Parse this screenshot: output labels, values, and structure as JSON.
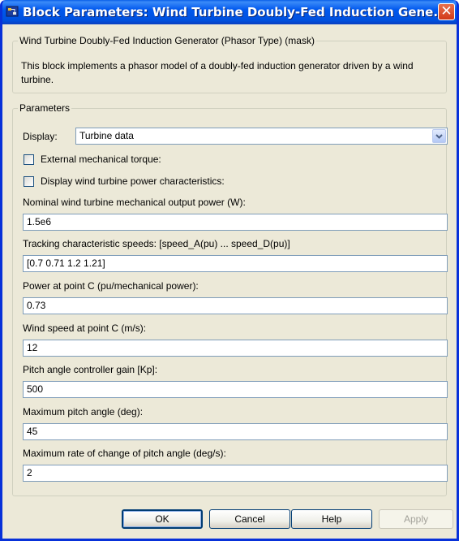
{
  "window": {
    "title": "Block Parameters: Wind Turbine Doubly-Fed Induction Gene...",
    "close_glyph": "✕"
  },
  "description_group": {
    "legend": "Wind Turbine Doubly-Fed Induction Generator (Phasor Type) (mask)",
    "text": "This block implements a phasor model of a doubly-fed induction generator driven by a wind turbine."
  },
  "parameters_group": {
    "legend": "Parameters",
    "display_label": "Display:",
    "display_value": "Turbine data",
    "checkboxes": [
      {
        "label": "External mechanical torque:",
        "checked": false
      },
      {
        "label": "Display wind turbine power characteristics:",
        "checked": false
      }
    ],
    "fields": [
      {
        "label": "Nominal wind turbine mechanical output power (W):",
        "value": "1.5e6"
      },
      {
        "label": "Tracking characteristic speeds: [speed_A(pu) ... speed_D(pu)]",
        "value": "[0.7 0.71 1.2 1.21]"
      },
      {
        "label": "Power at point C (pu/mechanical power):",
        "value": "0.73"
      },
      {
        "label": "Wind speed at point C (m/s):",
        "value": "12"
      },
      {
        "label": "Pitch angle controller gain [Kp]:",
        "value": "500"
      },
      {
        "label": "Maximum pitch angle (deg):",
        "value": "45"
      },
      {
        "label": "Maximum rate of change of pitch angle (deg/s):",
        "value": "2"
      }
    ]
  },
  "buttons": {
    "ok": "OK",
    "cancel": "Cancel",
    "help": "Help",
    "apply": "Apply"
  },
  "icons": [
    "block-parameters-icon",
    "close-icon",
    "chevron-down-icon"
  ],
  "colors": {
    "titlebar": "#0058EE",
    "dialog_bg": "#ECE9D8",
    "close": "#D23A18"
  }
}
